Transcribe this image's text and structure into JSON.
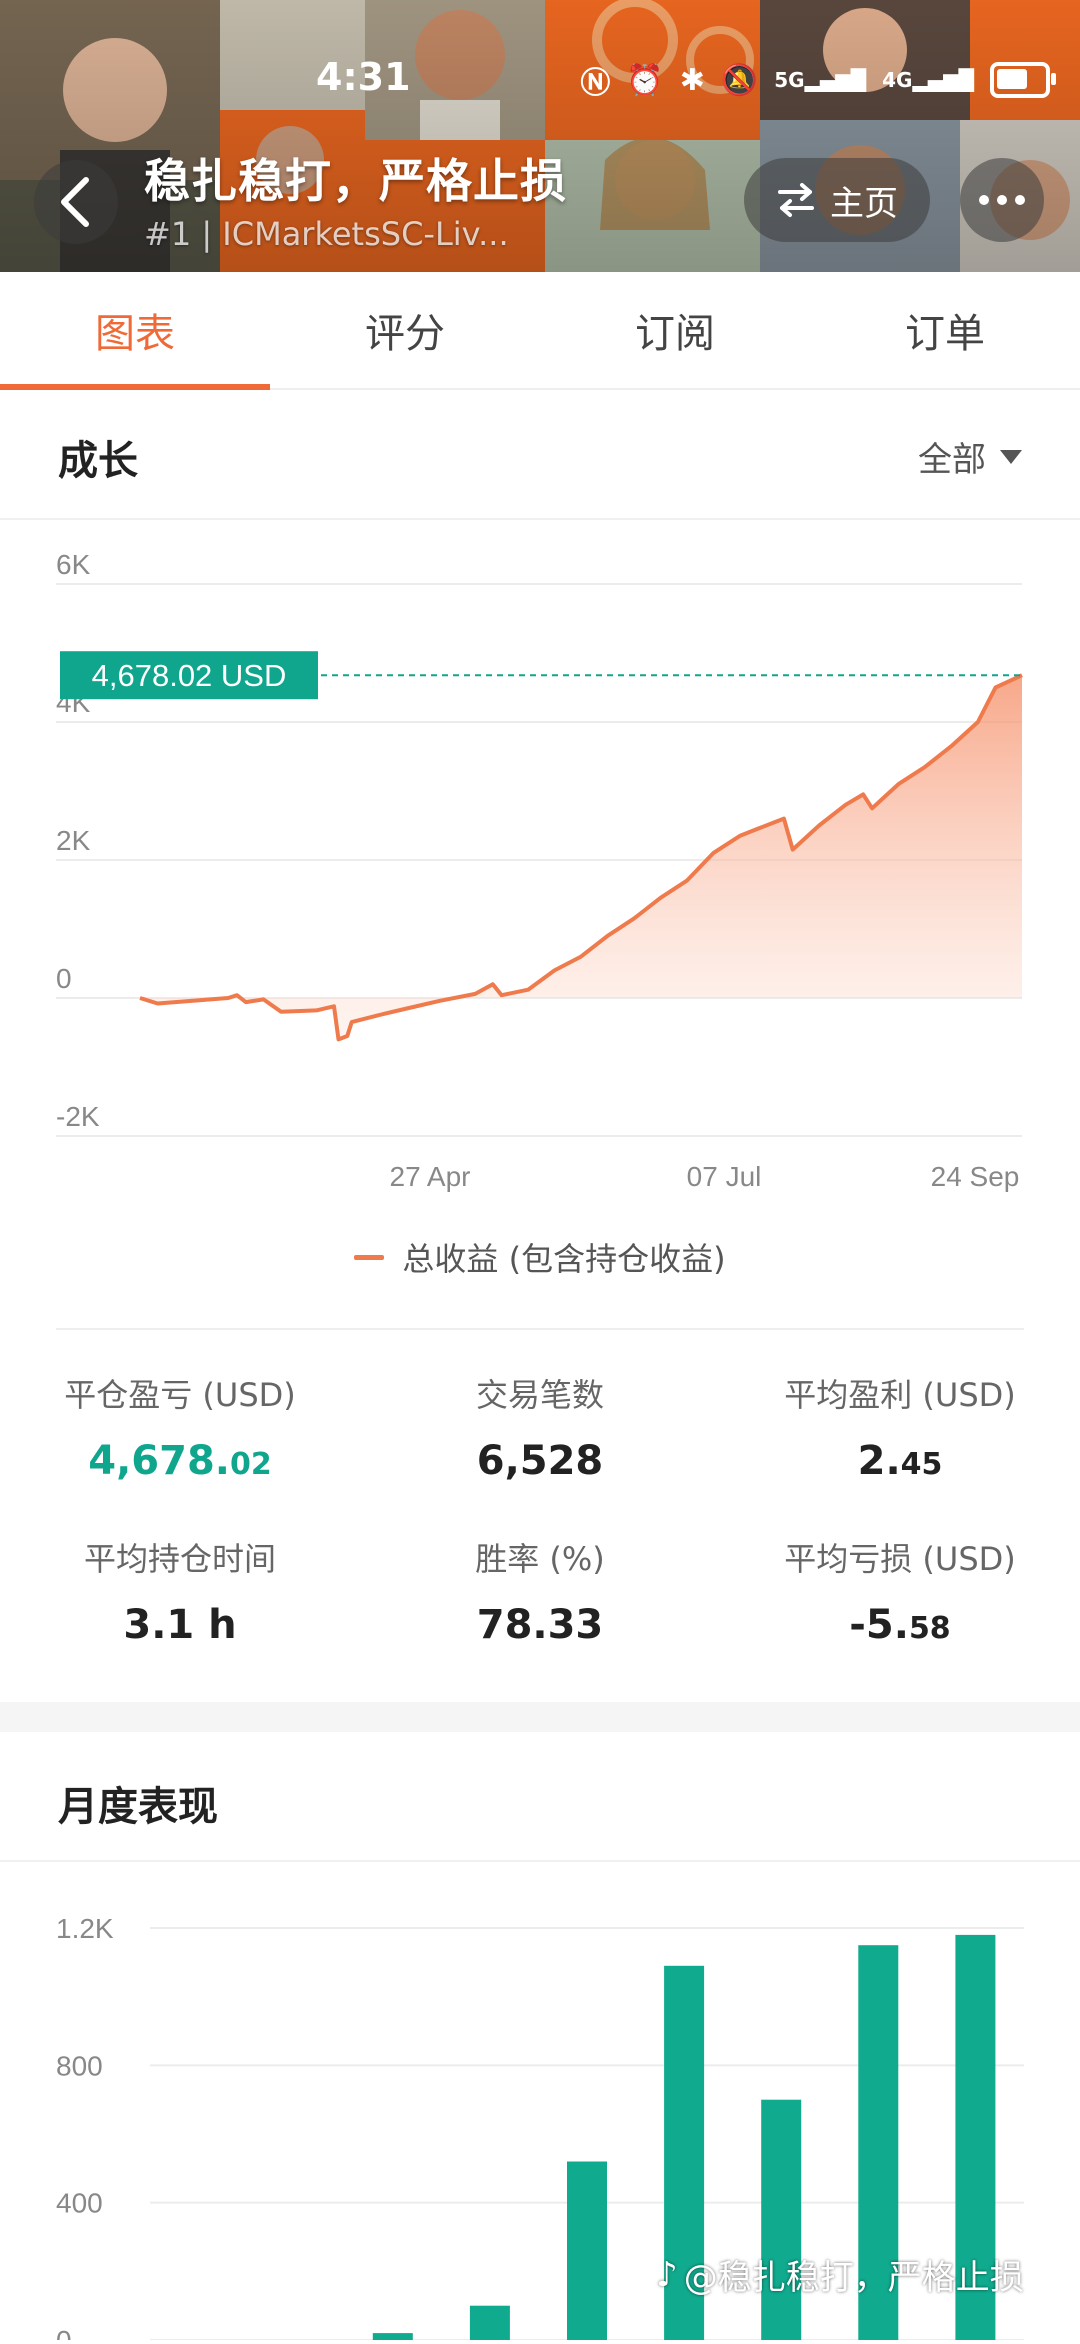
{
  "status_bar": {
    "time": "4:31",
    "signal_5g": "5G",
    "signal_4g": "4G"
  },
  "header": {
    "title": "稳扎稳打，严格止损",
    "subtitle": "#1 | ICMarketsSC-Liv...",
    "home_label": "主页",
    "accent_color": "#f26a21"
  },
  "tabs": [
    {
      "label": "图表",
      "active": true
    },
    {
      "label": "评分",
      "active": false
    },
    {
      "label": "订阅",
      "active": false
    },
    {
      "label": "订单",
      "active": false
    }
  ],
  "growth": {
    "title": "成长",
    "range_label": "全部",
    "legend_label": "总收益 (包含持仓收益)"
  },
  "chart_data": [
    {
      "type": "area",
      "ylim": [
        -2000,
        6000
      ],
      "ytick_labels": [
        "6K",
        "4K",
        "2K",
        "0",
        "-2K"
      ],
      "yticks": [
        6000,
        4000,
        2000,
        0,
        -2000
      ],
      "xtick_labels": [
        "27 Apr",
        "07 Jul",
        "24 Sep"
      ],
      "current_value_label": "4,678.02 USD",
      "current_value": 4678.02,
      "series": [
        {
          "name": "总收益 (包含持仓收益)",
          "color": "#ef7a4c",
          "points": [
            [
              0.0,
              0
            ],
            [
              0.02,
              -80
            ],
            [
              0.06,
              -40
            ],
            [
              0.1,
              0
            ],
            [
              0.11,
              40
            ],
            [
              0.12,
              -60
            ],
            [
              0.14,
              -20
            ],
            [
              0.16,
              -200
            ],
            [
              0.2,
              -180
            ],
            [
              0.22,
              -120
            ],
            [
              0.225,
              -600
            ],
            [
              0.235,
              -550
            ],
            [
              0.24,
              -350
            ],
            [
              0.27,
              -250
            ],
            [
              0.3,
              -160
            ],
            [
              0.34,
              -40
            ],
            [
              0.38,
              60
            ],
            [
              0.4,
              200
            ],
            [
              0.41,
              40
            ],
            [
              0.44,
              120
            ],
            [
              0.47,
              400
            ],
            [
              0.5,
              600
            ],
            [
              0.53,
              900
            ],
            [
              0.56,
              1150
            ],
            [
              0.59,
              1450
            ],
            [
              0.62,
              1700
            ],
            [
              0.65,
              2100
            ],
            [
              0.68,
              2350
            ],
            [
              0.7,
              2450
            ],
            [
              0.73,
              2600
            ],
            [
              0.74,
              2150
            ],
            [
              0.77,
              2500
            ],
            [
              0.8,
              2800
            ],
            [
              0.82,
              2950
            ],
            [
              0.83,
              2750
            ],
            [
              0.86,
              3100
            ],
            [
              0.89,
              3350
            ],
            [
              0.92,
              3650
            ],
            [
              0.95,
              4000
            ],
            [
              0.97,
              4500
            ],
            [
              1.0,
              4678
            ]
          ]
        }
      ]
    },
    {
      "type": "bar",
      "ylim": [
        0,
        1200
      ],
      "ytick_labels": [
        "1.2K",
        "800",
        "400",
        "0"
      ],
      "yticks": [
        1200,
        800,
        400,
        0
      ],
      "values": [
        0,
        0,
        20,
        100,
        520,
        1090,
        700,
        1150,
        1180
      ],
      "color": "#10ab8f"
    }
  ],
  "stats": {
    "closed_pnl_label": "平仓盈亏 (USD)",
    "closed_pnl_main": "4,678.",
    "closed_pnl_dec": "02",
    "trades_label": "交易笔数",
    "trades_value": "6,528",
    "avg_profit_label": "平均盈利 (USD)",
    "avg_profit_main": "2.",
    "avg_profit_dec": "45",
    "avg_hold_label": "平均持仓时间",
    "avg_hold_value": "3.1 h",
    "win_rate_label": "胜率 (%)",
    "win_rate_value": "78.33",
    "avg_loss_label": "平均亏损 (USD)",
    "avg_loss_main": "-5.",
    "avg_loss_dec": "58"
  },
  "monthly": {
    "title": "月度表现"
  },
  "watermark": "@稳扎稳打，严格止损"
}
